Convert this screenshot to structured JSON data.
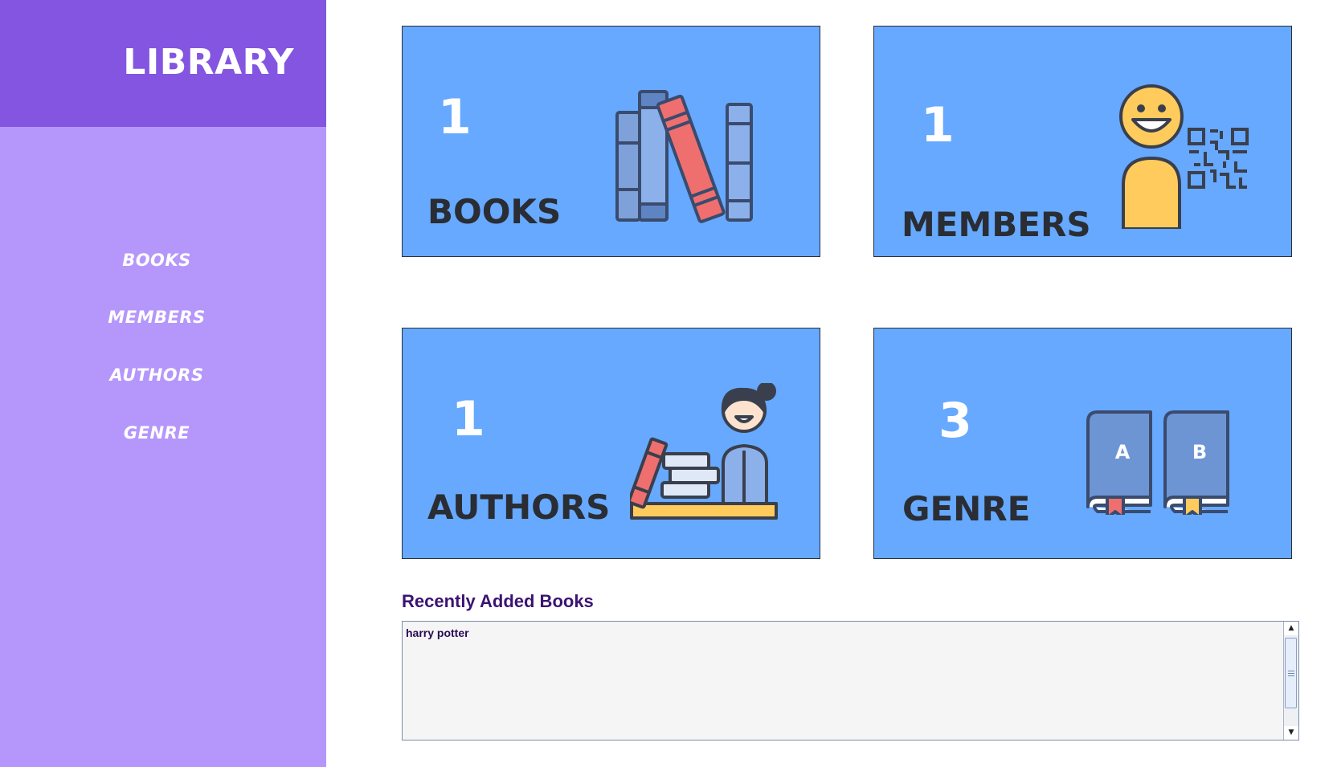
{
  "sidebar": {
    "title": "LIBRARY",
    "nav": [
      {
        "label": "BOOKS"
      },
      {
        "label": "MEMBERS"
      },
      {
        "label": "AUTHORS"
      },
      {
        "label": "GENRE"
      }
    ]
  },
  "cards": [
    {
      "count": "1",
      "label": "BOOKS",
      "icon": "books-shelf-icon"
    },
    {
      "count": "1",
      "label": "MEMBERS",
      "icon": "member-qr-icon"
    },
    {
      "count": "1",
      "label": "AUTHORS",
      "icon": "author-desk-icon"
    },
    {
      "count": "3",
      "label": "GENRE",
      "icon": "genre-books-icon"
    }
  ],
  "recent": {
    "title": "Recently Added Books",
    "items": [
      "harry potter"
    ]
  },
  "colors": {
    "sidebar_header": "#8355e1",
    "sidebar_body": "#b597fb",
    "card_background": "#66a9fe",
    "card_label": "#2a2d33",
    "section_title": "#3b1472"
  }
}
